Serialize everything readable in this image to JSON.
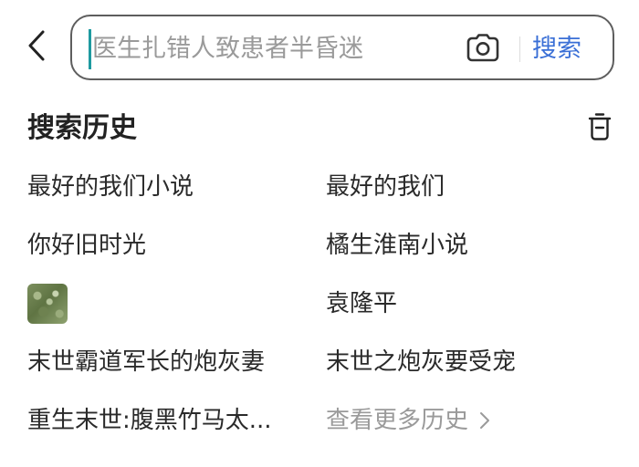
{
  "search": {
    "placeholder": "医生扎错人致患者半昏迷",
    "value": "",
    "submit_label": "搜索"
  },
  "icons": {
    "back": "chevron-left-icon",
    "camera": "camera-icon",
    "trash": "trash-icon",
    "more": "chevron-right-icon"
  },
  "colors": {
    "accent": "#3a6fd6",
    "caret": "#1e9aa0",
    "muted": "#9a9a9a"
  },
  "history": {
    "title": "搜索历史",
    "items": [
      {
        "label": "最好的我们小说"
      },
      {
        "label": "最好的我们"
      },
      {
        "label": "你好旧时光"
      },
      {
        "label": "橘生淮南小说"
      },
      {
        "label": ""
      },
      {
        "label": "袁隆平"
      },
      {
        "label": "末世霸道军长的炮灰妻"
      },
      {
        "label": "末世之炮灰要受宠"
      },
      {
        "label": "重生末世:腹黑竹马太..."
      }
    ],
    "more_label": "查看更多历史"
  }
}
